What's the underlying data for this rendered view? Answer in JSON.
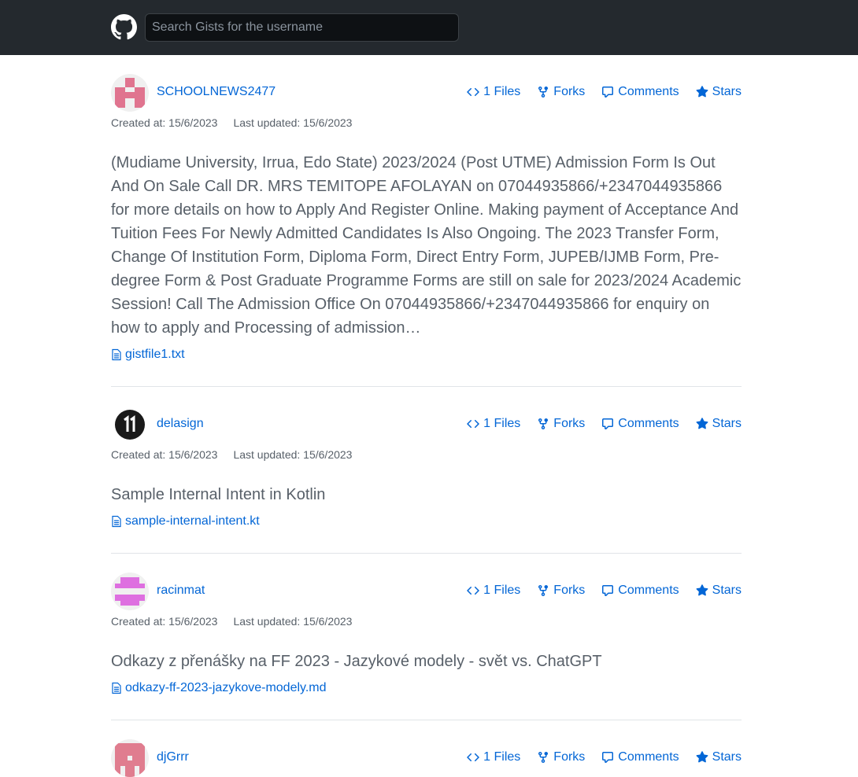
{
  "header": {
    "logo_icon": "github-mark-icon",
    "search_placeholder": "Search Gists for the username"
  },
  "gists": [
    {
      "username": "SCHOOLNEWS2477",
      "avatar_color": "#e0748f",
      "files_label": "1 Files",
      "forks_label": "Forks",
      "comments_label": "Comments",
      "stars_label": "Stars",
      "created": "Created at: 15/6/2023",
      "updated": "Last updated: 15/6/2023",
      "description": "(Mudiame University, Irrua, Edo State) 2023/2024 (Post UTME) Admission Form Is Out And On Sale Call DR. MRS TEMITOPE AFOLAYAN on 07044935866/+2347044935866 for more details on how to Apply And Register Online. Making payment of Acceptance And Tuition Fees For Newly Admitted Candidates Is Also Ongoing. The 2023 Transfer Form, Change Of Institution Form, Diploma Form, Direct Entry Form, JUPEB/IJMB Form, Pre-degree Form & Post Graduate Programme Forms are still on sale for 2023/2024 Academic Session! Call The Admission Office On 07044935866/+2347044935866 for enquiry on how to apply and Processing of admission…",
      "file": "gistfile1.txt"
    },
    {
      "username": "delasign",
      "avatar_color": "#1a1a1a",
      "files_label": "1 Files",
      "forks_label": "Forks",
      "comments_label": "Comments",
      "stars_label": "Stars",
      "created": "Created at: 15/6/2023",
      "updated": "Last updated: 15/6/2023",
      "description": "Sample Internal Intent in Kotlin",
      "file": "sample-internal-intent.kt"
    },
    {
      "username": "racinmat",
      "avatar_color": "#de6fe0",
      "files_label": "1 Files",
      "forks_label": "Forks",
      "comments_label": "Comments",
      "stars_label": "Stars",
      "created": "Created at: 15/6/2023",
      "updated": "Last updated: 15/6/2023",
      "description": "Odkazy z přenášky na FF 2023 - Jazykové modely - svět vs. ChatGPT",
      "file": "odkazy-ff-2023-jazykove-modely.md"
    },
    {
      "username": "djGrrr",
      "avatar_color": "#e07d8f",
      "files_label": "1 Files",
      "forks_label": "Forks",
      "comments_label": "Comments",
      "stars_label": "Stars"
    }
  ]
}
